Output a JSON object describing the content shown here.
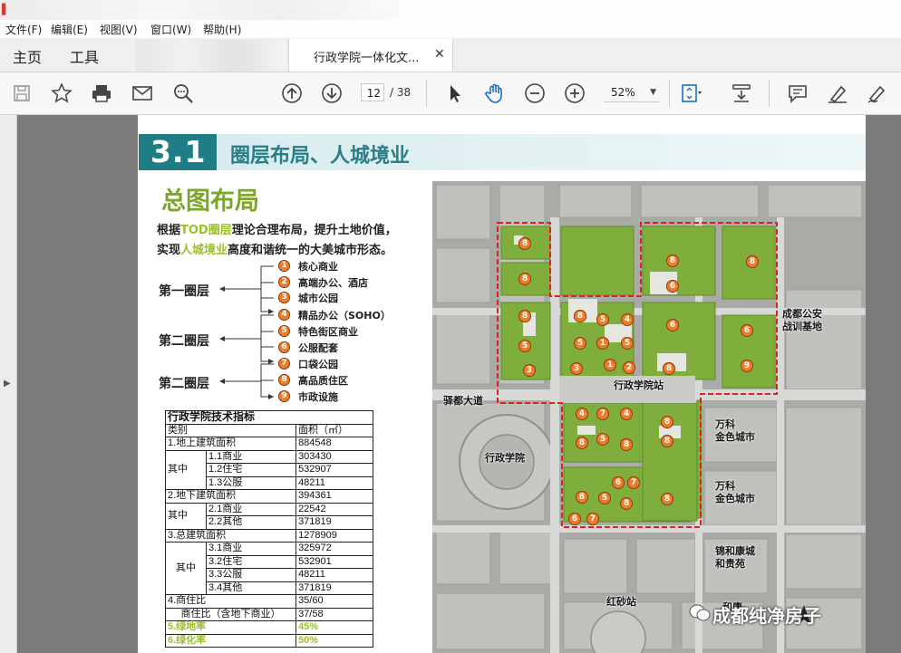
{
  "menubar": {
    "items": [
      "文件(F)",
      "编辑(E)",
      "视图(V)",
      "窗口(W)",
      "帮助(H)"
    ]
  },
  "tabs": {
    "home": "主页",
    "tools": "工具",
    "document_title": "行政学院一体化文...",
    "close_glyph": "✕"
  },
  "toolbar": {
    "current_page": "12",
    "page_total": "/ 38",
    "zoom": "52%"
  },
  "page": {
    "section_number": "3.1",
    "section_title": "圈层布局、人城境业",
    "subtitle": "总图布局",
    "desc_line1_a": "根据",
    "desc_line1_hl": "TOD圈层",
    "desc_line1_b": "理论合理布局，提升土地价值，",
    "desc_line2_a": "实现",
    "desc_line2_hl": "人城境业",
    "desc_line2_b": "高度和谐统一的大美城市形态。",
    "layers": [
      "第一圈层",
      "第二圈层",
      "第二圈层"
    ],
    "legend": [
      {
        "n": "1",
        "label": "核心商业"
      },
      {
        "n": "2",
        "label": "高端办公、酒店"
      },
      {
        "n": "3",
        "label": "城市公园"
      },
      {
        "n": "4",
        "label": "精品办公（SOHO）"
      },
      {
        "n": "5",
        "label": "特色街区商业"
      },
      {
        "n": "6",
        "label": "公服配套"
      },
      {
        "n": "7",
        "label": "口袋公园"
      },
      {
        "n": "8",
        "label": "高品质住区"
      },
      {
        "n": "9",
        "label": "市政设施"
      }
    ],
    "table": {
      "title": "行政学院技术指标",
      "head": [
        "类别",
        "面积（㎡）"
      ],
      "r1": [
        "1.地上建筑面积",
        "884548"
      ],
      "r1_group": "其中",
      "r1_sub": [
        [
          "1.1商业",
          "303430"
        ],
        [
          "1.2住宅",
          "532907"
        ],
        [
          "1.3公服",
          "48211"
        ]
      ],
      "r2": [
        "2.地下建筑面积",
        "394361"
      ],
      "r2_group": "其中",
      "r2_sub": [
        [
          "2.1商业",
          "22542"
        ],
        [
          "2.2其他",
          "371819"
        ]
      ],
      "r3": [
        "3.总建筑面积",
        "1278909"
      ],
      "r3_group": "其中",
      "r3_sub": [
        [
          "3.1商业",
          "325972"
        ],
        [
          "3.2住宅",
          "532901"
        ],
        [
          "3.3公服",
          "48211"
        ],
        [
          "3.4其他",
          "371819"
        ]
      ],
      "r4": [
        "4.商住比",
        "35/60"
      ],
      "r4b": [
        "商住比（含地下商业）",
        "37/58"
      ],
      "r5": [
        "5.绿地率",
        "45%"
      ],
      "r6": [
        "6.绿化率",
        "50%"
      ]
    },
    "map": {
      "labels": {
        "station": "行政学院站",
        "road": "驿都大道",
        "academy": "行政学院",
        "base_l1": "成都公安",
        "base_l2": "战训基地",
        "wanke1_l1": "万科",
        "wanke1_l2": "金色城市",
        "wanke2_l1": "万科",
        "wanke2_l2": "金色城市",
        "jinhe_l1": "锦和康城",
        "jinhe_l2": "和贵苑",
        "hongsha": "红砂站",
        "hekang": "和康"
      },
      "watermark": "成都纯净房子",
      "accent_colors": {
        "boundary": "#e0201b",
        "marker": "#ee7d2b",
        "green": "#7fae3c"
      }
    }
  }
}
